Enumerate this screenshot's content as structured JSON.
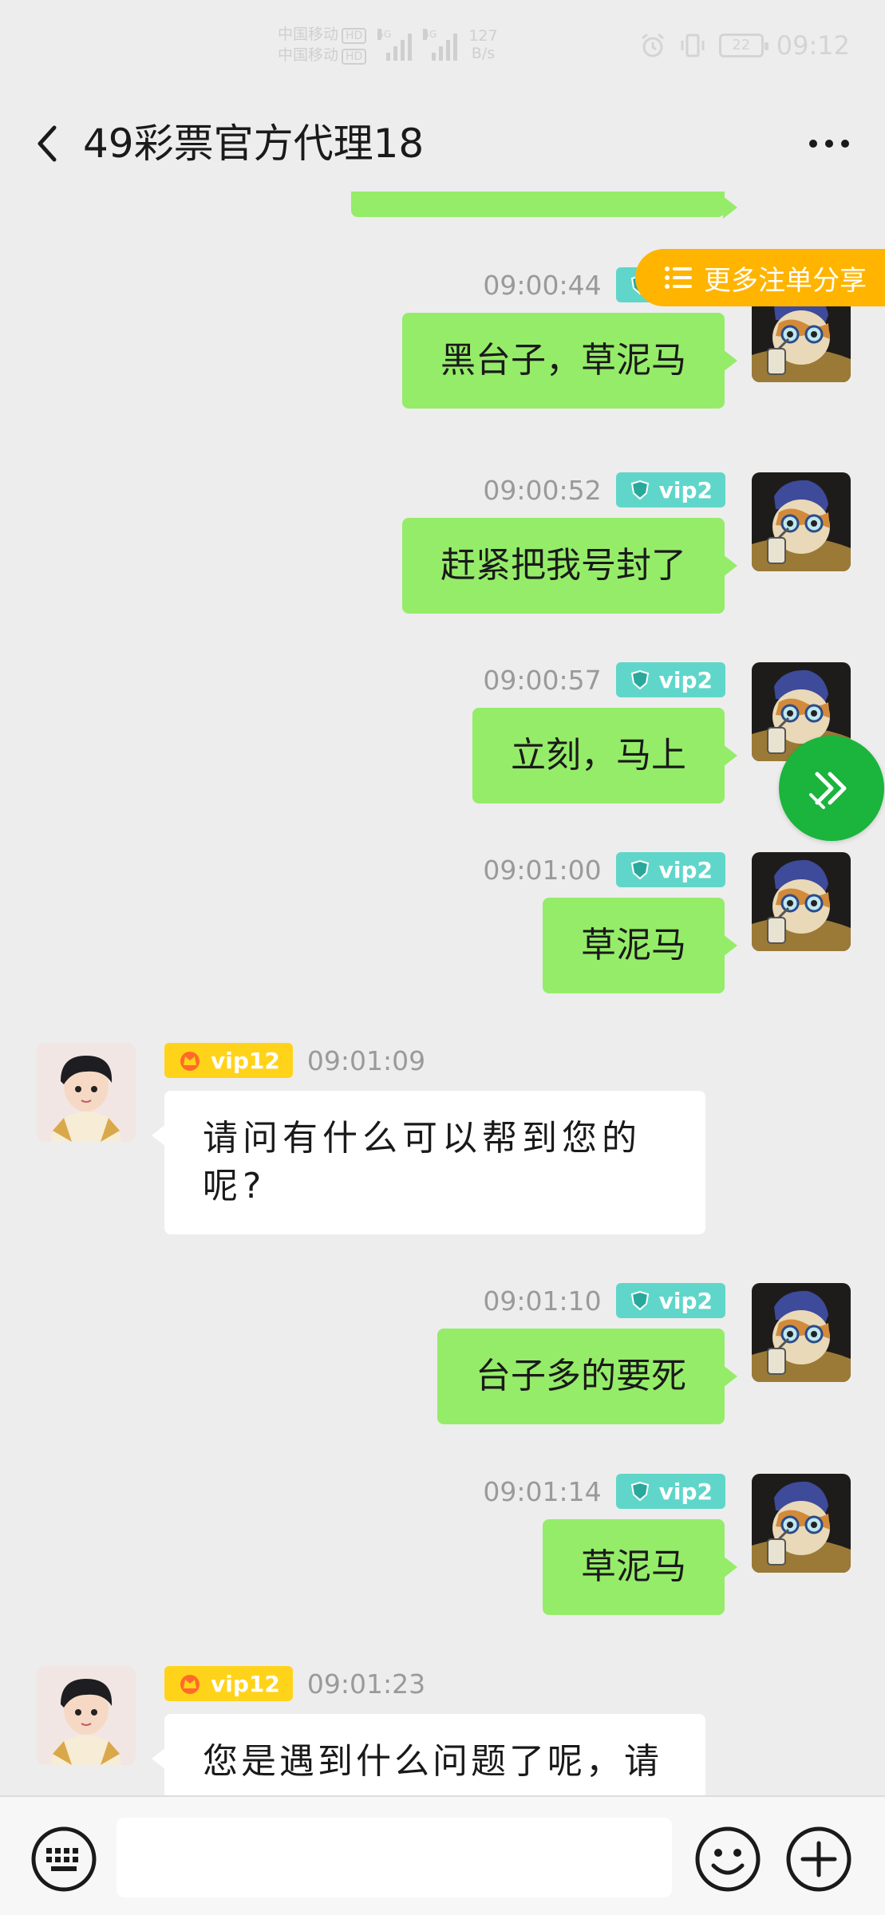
{
  "status_bar": {
    "carrier_1": "中国移动",
    "carrier_2": "中国移动",
    "hd_badge": "HD",
    "net_1": "5G",
    "net_2": "4G",
    "rate_value": "127",
    "rate_unit": "B/s",
    "battery": "22",
    "clock": "09:12"
  },
  "header": {
    "title": "49彩票官方代理18"
  },
  "float_share": {
    "label": "更多注单分享",
    "color": "#ffb400"
  },
  "messages": [
    {
      "side": "me",
      "time": "09:00:44",
      "vip": "vip2",
      "text": "黑台子，草泥马"
    },
    {
      "side": "me",
      "time": "09:00:52",
      "vip": "vip2",
      "text": "赶紧把我号封了"
    },
    {
      "side": "me",
      "time": "09:00:57",
      "vip": "vip2",
      "text": "立刻，马上"
    },
    {
      "side": "me",
      "time": "09:01:00",
      "vip": "vip2",
      "text": "草泥马"
    },
    {
      "side": "them",
      "time": "09:01:09",
      "vip": "vip12",
      "text_line1": "请问有什么可以帮到您的",
      "text_line2": "呢?"
    },
    {
      "side": "me",
      "time": "09:01:10",
      "vip": "vip2",
      "text": "台子多的要死"
    },
    {
      "side": "me",
      "time": "09:01:14",
      "vip": "vip2",
      "text": "草泥马"
    },
    {
      "side": "them",
      "time": "09:01:23",
      "vip": "vip12",
      "text_line1": "您是遇到什么问题了呢，请"
    }
  ],
  "colors": {
    "background": "#ededed",
    "my_bubble": "#95ec69",
    "their_bubble": "#ffffff",
    "vip2_badge": "#5fd6c9",
    "vip12_badge": "#ffd31a",
    "fab": "#1bb43d"
  },
  "icons": {
    "back": "chevron-left-icon",
    "more": "more-dots-icon",
    "keyboard": "keyboard-icon",
    "emoji": "smiley-icon",
    "plus": "plus-circle-icon",
    "fab": "double-chevron-right-icon",
    "share": "list-icon"
  }
}
